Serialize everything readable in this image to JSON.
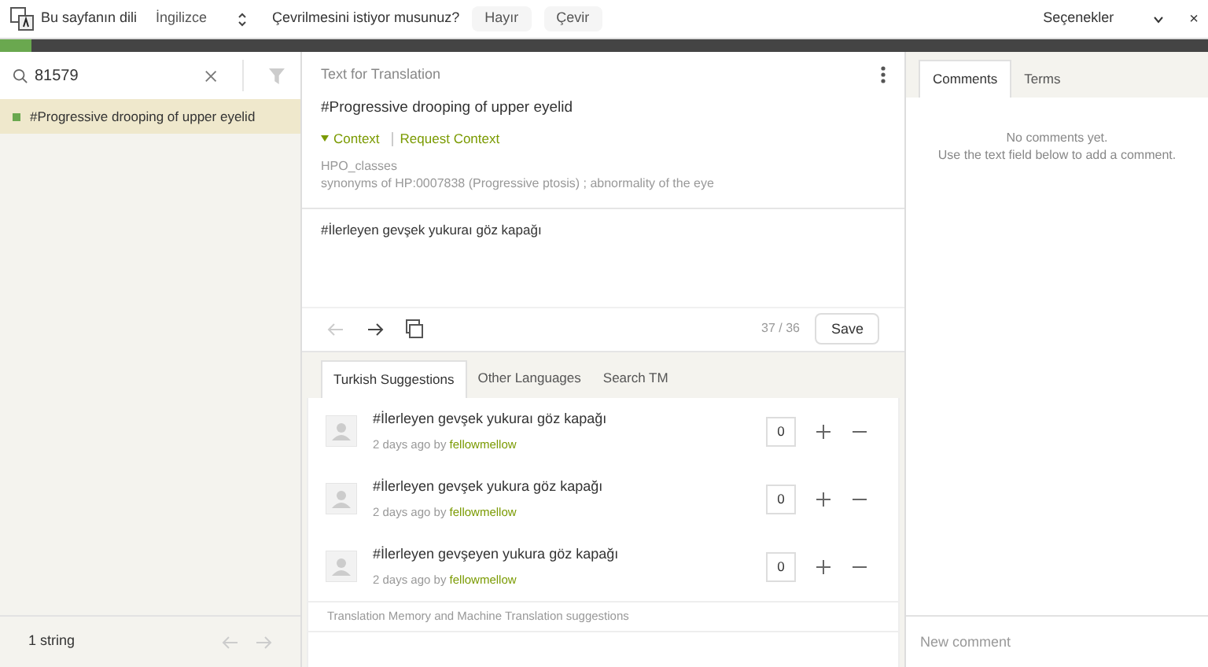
{
  "translate_bar": {
    "page_language_label": "Bu sayfanın dili",
    "language": "İngilizce",
    "question": "Çevrilmesini istiyor musunuz?",
    "buttons": [
      "Hayır",
      "Çevir"
    ],
    "options": "Seçenekler",
    "close": "×"
  },
  "sidebar": {
    "search": {
      "value": "81579"
    },
    "items": [
      {
        "text": "#Progressive drooping of upper eyelid",
        "selected": true,
        "color": "#6aa84f"
      }
    ],
    "count": "1 string"
  },
  "source": {
    "header": "Text for Translation",
    "text": "#Progressive drooping of upper eyelid",
    "context_toggle": "Context",
    "expanded": true,
    "request_context": "Request Context",
    "context_lines": [
      "HPO_classes",
      "synonyms of HP:0007838 (Progressive ptosis) ; abnormality of the eye"
    ]
  },
  "translation": {
    "value": "#İlerleyen gevşek yukuraı göz kapağı",
    "char_count": "37 / 36",
    "save": "Save"
  },
  "helper_tabs": [
    {
      "label": "Turkish Suggestions",
      "selected": true
    },
    {
      "label": "Other Languages",
      "selected": false
    },
    {
      "label": "Search TM",
      "selected": false
    }
  ],
  "suggestions": [
    {
      "text": "#İlerleyen gevşek yukuraı göz kapağı",
      "meta": "2 days ago by",
      "user": "fellowmellow",
      "votes": "0"
    },
    {
      "text": "#İlerleyen gevşek yukura göz kapağı",
      "meta": "2 days ago by",
      "user": "fellowmellow",
      "votes": "0"
    },
    {
      "text": "#İlerleyen gevşeyen yukura göz kapağı",
      "meta": "2 days ago by",
      "user": "fellowmellow",
      "votes": "0"
    }
  ],
  "suggestions_footer": "Translation Memory and Machine Translation suggestions",
  "comments_tabs": [
    {
      "label": "Comments",
      "selected": true
    },
    {
      "label": "Terms",
      "selected": false
    }
  ],
  "comments_empty": [
    "No comments yet.",
    "Use the text field below to add a comment."
  ],
  "new_comment": {
    "placeholder": "New comment"
  }
}
